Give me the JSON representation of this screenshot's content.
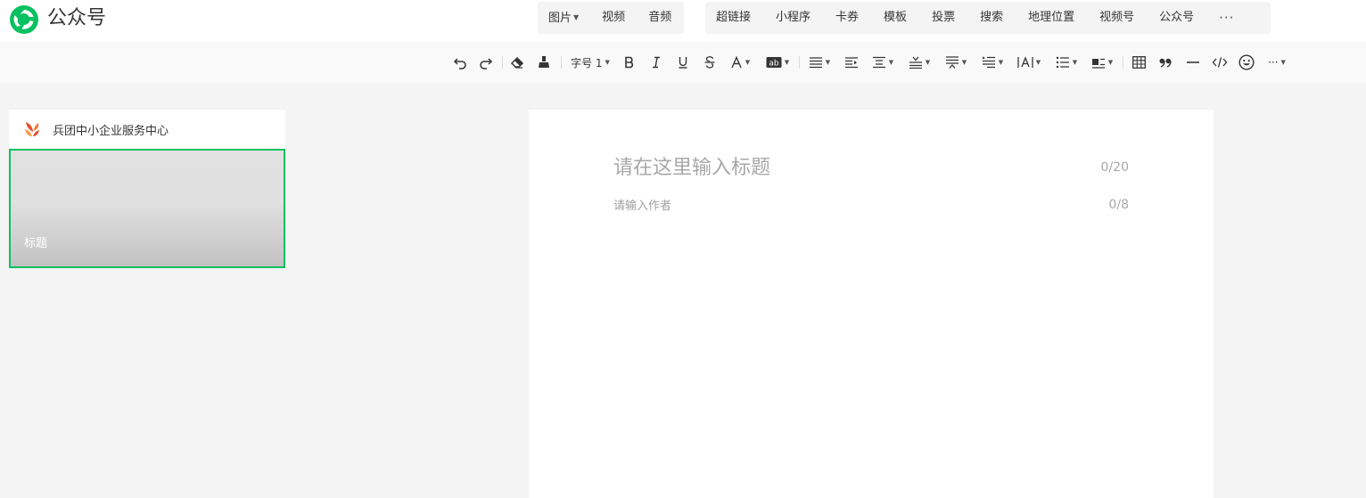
{
  "app": {
    "brand": "公众号",
    "brand_color": "#07c160"
  },
  "insert_bar": {
    "media": [
      {
        "label": "图片",
        "dropdown": true
      },
      {
        "label": "视频",
        "dropdown": false
      },
      {
        "label": "音频",
        "dropdown": false
      }
    ],
    "tools": [
      "超链接",
      "小程序",
      "卡券",
      "模板",
      "投票",
      "搜索",
      "地理位置",
      "视频号",
      "公众号"
    ],
    "more": "···"
  },
  "format_toolbar": {
    "font_size_label": "字号 1",
    "more": "···",
    "icons": [
      "undo-icon",
      "redo-icon",
      "eraser-icon",
      "format-painter-icon",
      "font-size",
      "bold-icon",
      "italic-icon",
      "underline-icon",
      "strikethrough-icon",
      "font-color-icon",
      "background-color-icon",
      "align-icon",
      "indent-icon",
      "paragraph-spacing-icon",
      "line-spacing-before-icon",
      "line-spacing-after-icon",
      "first-line-indent-icon",
      "letter-spacing-icon",
      "list-icon",
      "float-align-icon",
      "table-icon",
      "quote-icon",
      "divider-icon",
      "code-icon",
      "emoji-icon",
      "more-icon"
    ]
  },
  "sidebar": {
    "account_name": "兵团中小企业服务中心",
    "article_card": {
      "title": "标题",
      "selected_border": "#07c160"
    }
  },
  "editor": {
    "title_placeholder": "请在这里输入标题",
    "title_counter": "0/20",
    "author_placeholder": "请输入作者",
    "author_counter": "0/8"
  }
}
